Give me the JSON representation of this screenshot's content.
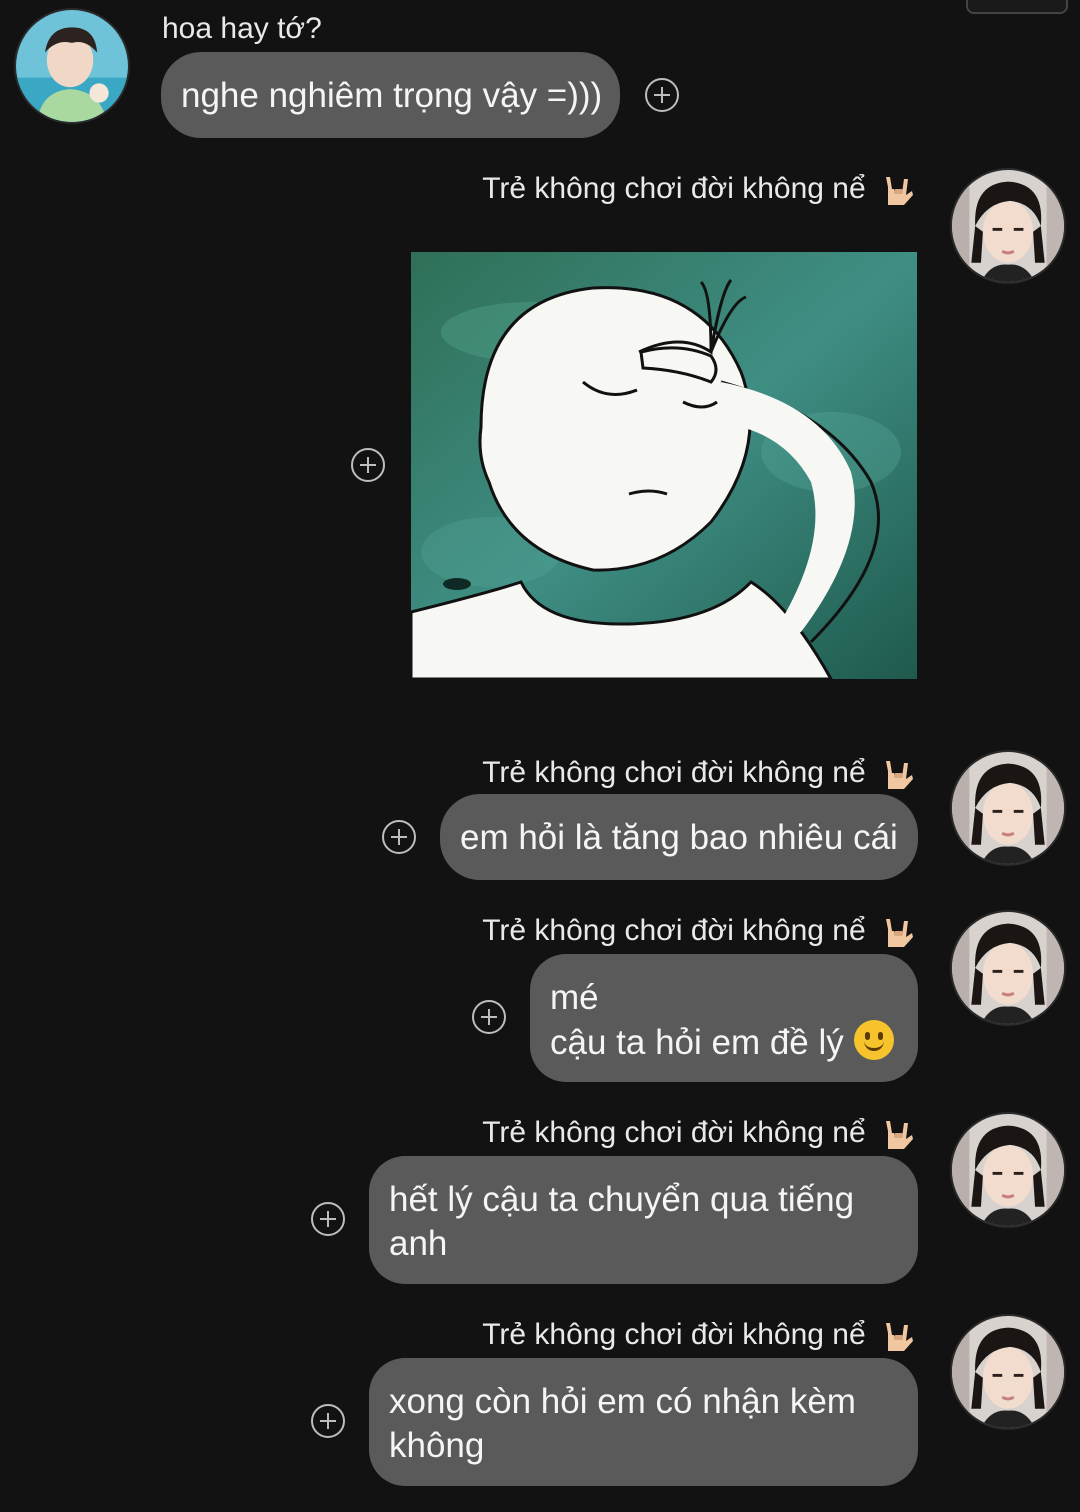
{
  "messages": {
    "m1": {
      "sender": "hoa hay tớ?",
      "text": "nghe nghiêm trọng vậy =)))"
    },
    "m2": {
      "sender": "Trẻ không chơi đời không nể"
    },
    "m3": {
      "sender": "Trẻ không chơi đời không nể",
      "text": "em hỏi là tăng bao nhiêu cái"
    },
    "m4": {
      "sender": "Trẻ không chơi đời không nể",
      "line1": "mé",
      "line2": "cậu ta hỏi em đề lý"
    },
    "m5": {
      "sender": "Trẻ không chơi đời không nể",
      "line1": "hết lý cậu ta chuyển qua tiếng",
      "line2": "anh"
    },
    "m6": {
      "sender": "Trẻ không chơi đời không nể",
      "line1": "xong còn hỏi em có nhận kèm",
      "line2": "không"
    }
  },
  "icons": {
    "add_reaction": "plus-circle-icon",
    "hand_emoji": "love-you-gesture-emoji",
    "smile_emoji": "slightly-smiling-face-emoji"
  },
  "colors": {
    "background": "#121212",
    "bubble": "#5a5a5a",
    "text": "#f5f5f5"
  }
}
